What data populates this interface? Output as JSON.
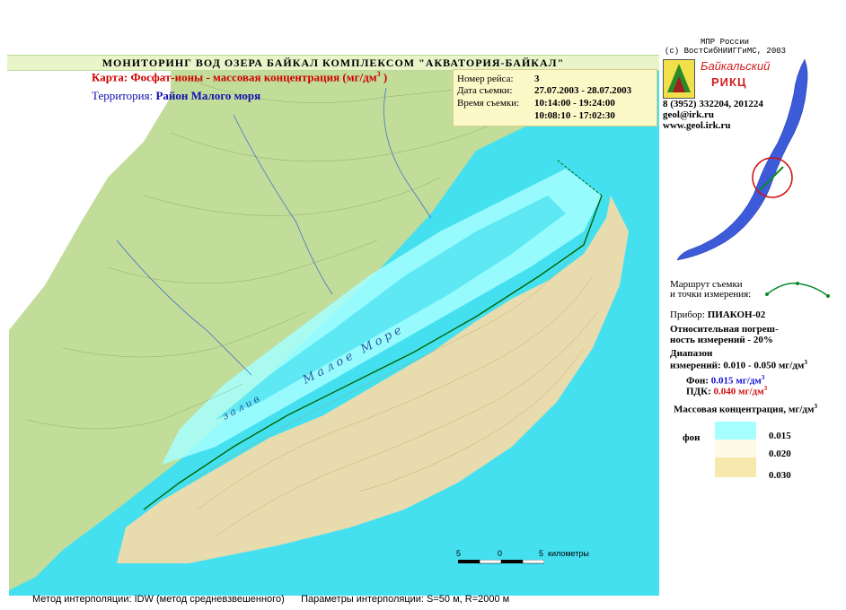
{
  "credits": {
    "org_line1": "МПР России",
    "org_line2": "(с) ВостСибНИИГГиМС, 2003",
    "logo_text1": "Байкальский",
    "logo_text2": "РИКЦ",
    "phone": "8 (3952) 332204, 201224",
    "email": "geol@irk.ru",
    "website": "www.geol.irk.ru"
  },
  "header": {
    "banner": "МОНИТОРИНГ  ВОД  ОЗЕРА  БАЙКАЛ  КОМПЛЕКСОМ  \"АКВАТОРИЯ-БАЙКАЛ\"",
    "map_label": "Карта:",
    "map_title": "Фосфат-ионы - массовая концентрация  (мг/дм",
    "map_title_sup": "3",
    "map_title_end": ")",
    "territory_label": "Территория:",
    "territory_value": "Район Малого моря"
  },
  "survey": {
    "trip_label": "Номер рейса:",
    "trip_value": "3",
    "date_label": "Дата съемки:",
    "date_value": "27.07.2003 - 28.07.2003",
    "time_label": "Время съемки:",
    "time_value1": "10:14:00 - 19:24:00",
    "time_value2": "10:08:10 - 17:02:30"
  },
  "legend": {
    "route_line1": "Маршрут съемки",
    "route_line2": "и точки измерения:",
    "device_label": "Прибор:",
    "device_value": "ПИАКОН-02",
    "error_line1": "Относительная погреш-",
    "error_line2": "ность измерений - 20%",
    "range_line1": "Диапазон",
    "range_line2": "измерений: 0.010 - 0.050 мг/дм",
    "range_sup": "3",
    "bg_label": "Фон:",
    "bg_value": "0.015 мг/дм",
    "bg_sup": "3",
    "mac_label": "ПДК:",
    "mac_value": "0.040 мг/дм",
    "mac_sup": "3",
    "conc_title": "Массовая концентрация, мг/дм",
    "conc_sup": "3",
    "fon_label": "фон",
    "classes": [
      {
        "value": "0.015",
        "color": "#a6ffff"
      },
      {
        "value": "0.020",
        "color": "#fdfbe6"
      },
      {
        "value": "0.030",
        "color": "#f7e9ad"
      }
    ]
  },
  "map": {
    "water_label_1": "Малое  Море",
    "water_label_2": "залив",
    "colors": {
      "water": "#44e0f0",
      "land": "#c2dc9a",
      "peninsula": "#e8dcae",
      "zone_0015": "#a6ffff"
    }
  },
  "scale": {
    "label_left": "5",
    "label_mid": "0",
    "label_right": "5",
    "unit": "километры"
  },
  "footer": {
    "method": "Метод интерполяции: IDW (метод средневзвешенного)",
    "params": "Параметры  интерполяции:  S=50 м,  R=2000 м"
  }
}
